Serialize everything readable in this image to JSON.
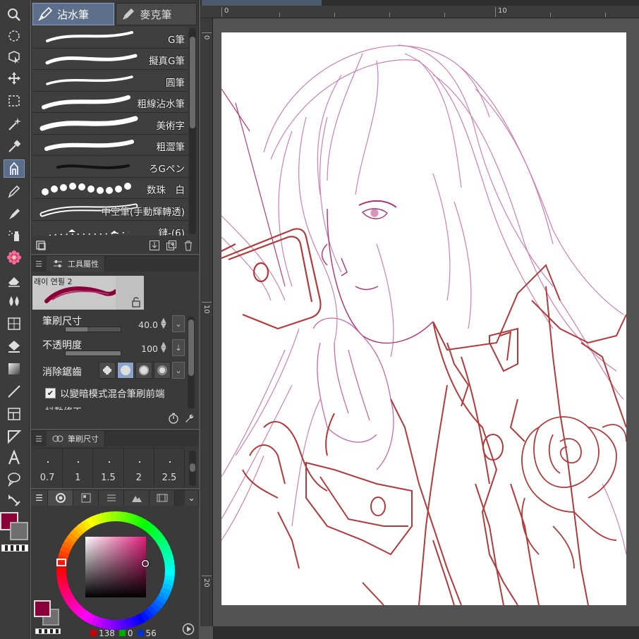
{
  "sub_tool_panel": {
    "tabs": [
      {
        "label": "沾水筆",
        "icon": "dip-pen-icon",
        "active": true
      },
      {
        "label": "麥克筆",
        "icon": "marker-icon",
        "active": false
      }
    ],
    "brushes": [
      {
        "label": "G筆"
      },
      {
        "label": "擬真G筆"
      },
      {
        "label": "圓筆"
      },
      {
        "label": "粗線沾水筆"
      },
      {
        "label": "美術字"
      },
      {
        "label": "粗澀筆"
      },
      {
        "label": "ろGペン"
      },
      {
        "label": "数珠　白"
      },
      {
        "label": "中空筆(手動輝轉透)"
      },
      {
        "label": "鏈-(6)"
      }
    ]
  },
  "tool_property": {
    "title": "工具屬性",
    "preset_name": "래이 연필 2",
    "brush_size_label": "筆刷尺寸",
    "brush_size_value": "40.0",
    "brush_size_fraction": 0.4,
    "opacity_label": "不透明度",
    "opacity_value": "100",
    "opacity_fraction": 1.0,
    "antialias_label": "消除鋸齒",
    "checkbox_label": "以變暗模式混合筆刷前端",
    "cut_label": "抖動修正"
  },
  "brush_size_panel": {
    "title": "筆刷尺寸",
    "sizes": [
      "0.7",
      "1",
      "1.5",
      "2",
      "2.5"
    ]
  },
  "color_panel": {
    "r": "138",
    "g": "0",
    "b": "56",
    "main_color": "#8a0038",
    "sub_color": "#6e6e6e"
  },
  "canvas": {
    "ruler_top": [
      "0",
      "10"
    ],
    "ruler_left": [
      "0",
      "10",
      "20"
    ]
  },
  "colors": {
    "accent": "#5e6f8c",
    "sketch_red": "#b33a3a",
    "sketch_pink": "#c0609a"
  }
}
